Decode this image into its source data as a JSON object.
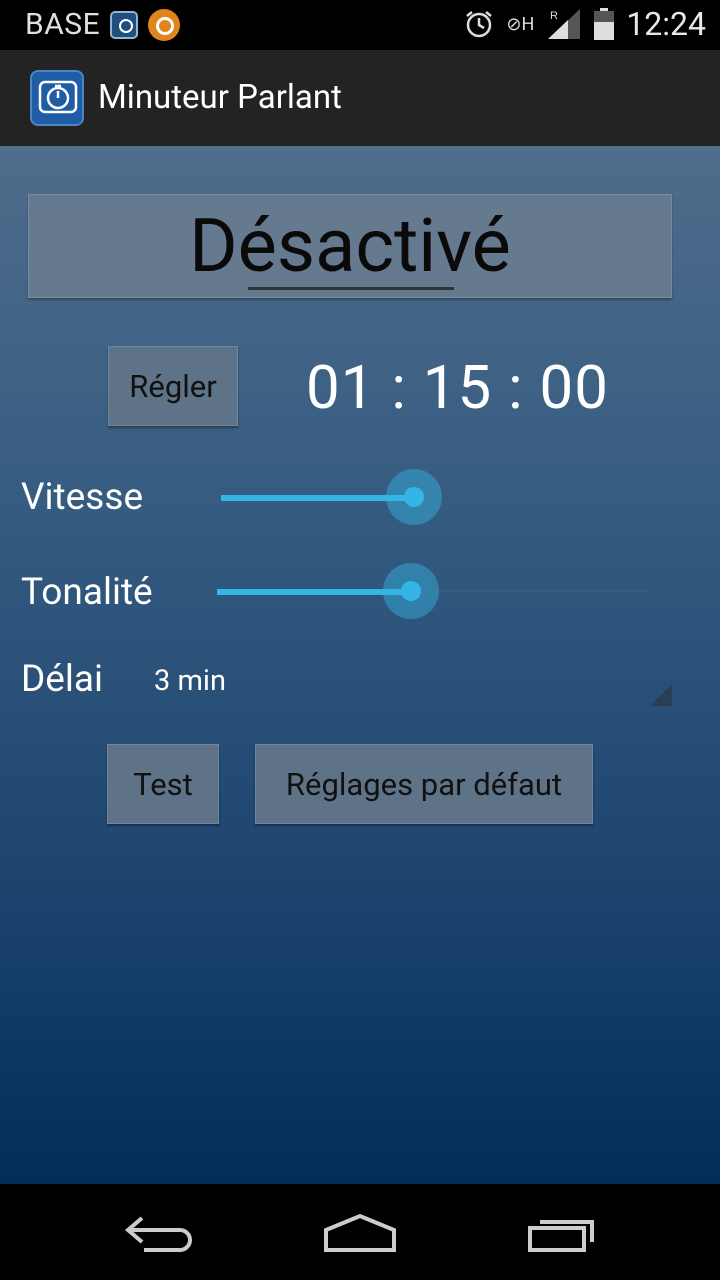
{
  "status_bar": {
    "carrier": "BASE",
    "time": "12:24",
    "icons": [
      "timer-notification-icon",
      "app-notification-icon",
      "alarm-icon",
      "no-sim-icon",
      "signal-icon",
      "battery-icon"
    ]
  },
  "action_bar": {
    "title": "Minuteur Parlant",
    "icon": "stopwatch-icon"
  },
  "main": {
    "state_button": "Désactivé",
    "set_button": "Régler",
    "timer": "01 : 15 : 00",
    "speed": {
      "label": "Vitesse",
      "value": 0.45
    },
    "pitch": {
      "label": "Tonalité",
      "value": 0.45
    },
    "delay": {
      "label": "Délai",
      "selected": "3 min"
    },
    "test_button": "Test",
    "defaults_button": "Réglages par défaut"
  },
  "nav_bar": {
    "icons": [
      "back-icon",
      "home-icon",
      "recents-icon"
    ]
  },
  "colors": {
    "accent": "#33b5e5",
    "action_bar": "#232323",
    "button": "#5e7388"
  }
}
